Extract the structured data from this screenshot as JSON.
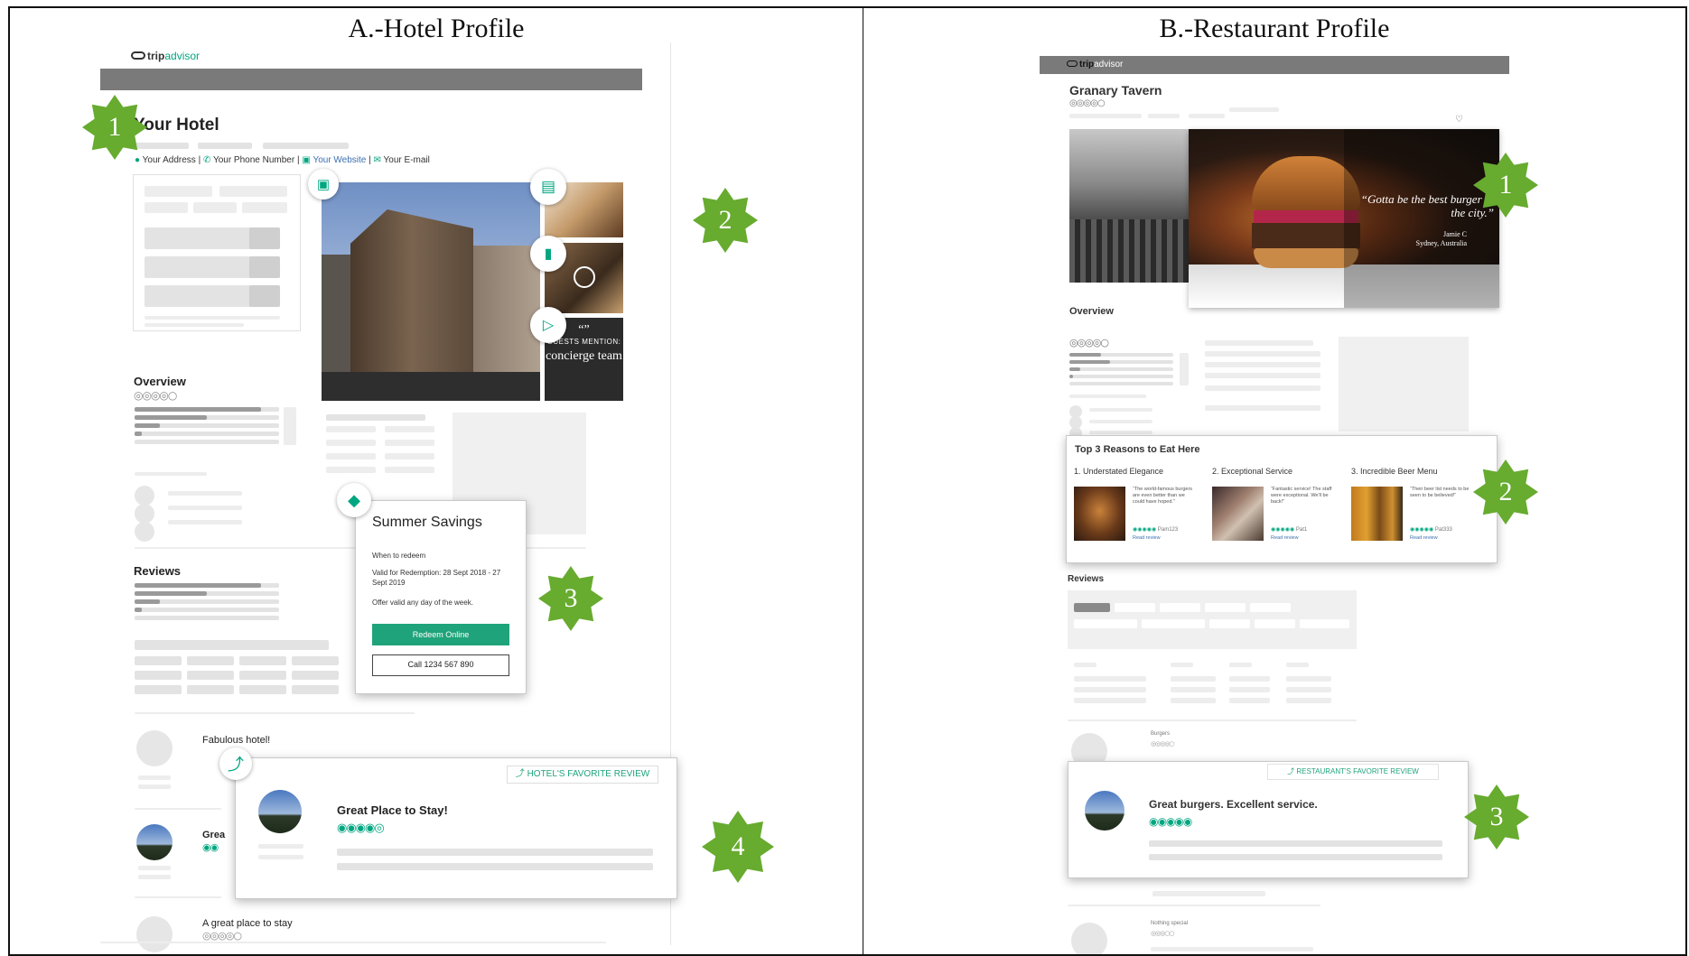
{
  "panel_a": {
    "title": "A.-Hotel Profile",
    "brand": {
      "trip": "trip",
      "advisor": "advisor"
    },
    "hotel_name": "Your Hotel",
    "contacts": {
      "address": "Your Address",
      "phone": "Your Phone Number",
      "website": "Your Website",
      "email": "Your E-mail",
      "sep": "|"
    },
    "guests_mention": {
      "quote": "“”",
      "label": "GUESTS MENTION:",
      "value": "concierge team"
    },
    "overview_label": "Overview",
    "rating_dots": "◎◎◎◎○",
    "reviews_label": "Reviews",
    "offer": {
      "title": "Summer Savings",
      "when_label": "When to redeem",
      "valid": "Valid for Redemption: 28 Sept 2018 - 27 Sept 2019",
      "note": "Offer valid any day of the week.",
      "redeem_button": "Redeem Online",
      "call_button": "Call 1234 567 890"
    },
    "review_1_title": "Fabulous hotel!",
    "review_2_title_partial": "Grea",
    "review_3_title": "A great place to stay",
    "favorite": {
      "badge": "HOTEL'S FAVORITE REVIEW",
      "title": "Great Place to Stay!",
      "rating": "◉◉◉◉◎"
    },
    "callouts": [
      "1",
      "2",
      "3",
      "4"
    ]
  },
  "panel_b": {
    "title": "B.-Restaurant Profile",
    "brand": {
      "trip": "trip",
      "advisor": "advisor"
    },
    "restaurant_name": "Granary Tavern",
    "rating_dots": "◎◎◎◎○",
    "quote": "“Gotta be the best burger in the city.”",
    "quote_author": "Jamie C",
    "quote_location": "Sydney, Australia",
    "overview_label": "Overview",
    "reasons": {
      "title": "Top 3 Reasons to Eat Here",
      "items": [
        {
          "label": "1. Understated Elegance",
          "text": "“The world-famous burgers are even better than we could have hoped.”",
          "user": "Pam123",
          "link": "Read review"
        },
        {
          "label": "2. Exceptional Service",
          "text": "“Fantastic service! The staff were exceptional. We'll be back!”",
          "user": "Pat1",
          "link": "Read review"
        },
        {
          "label": "3. Incredible Beer Menu",
          "text": "“Their beer list needs to be seen to be believed!”",
          "user": "Pat333",
          "link": "Read review"
        }
      ]
    },
    "reviews_label": "Reviews",
    "review_top_snippet": "Burgers",
    "review_bottom_snippet": "Nothing special",
    "favorite": {
      "badge": "RESTAURANT'S FAVORITE REVIEW",
      "title": "Great burgers. Excellent service.",
      "rating": "◉◉◉◉◉"
    },
    "callouts": [
      "1",
      "2",
      "3"
    ]
  },
  "colors": {
    "callout_green": "#67ab2f",
    "tripadvisor_green": "#00a680",
    "header_gray": "#7a7a7a",
    "link_blue": "#3a6fb0"
  }
}
